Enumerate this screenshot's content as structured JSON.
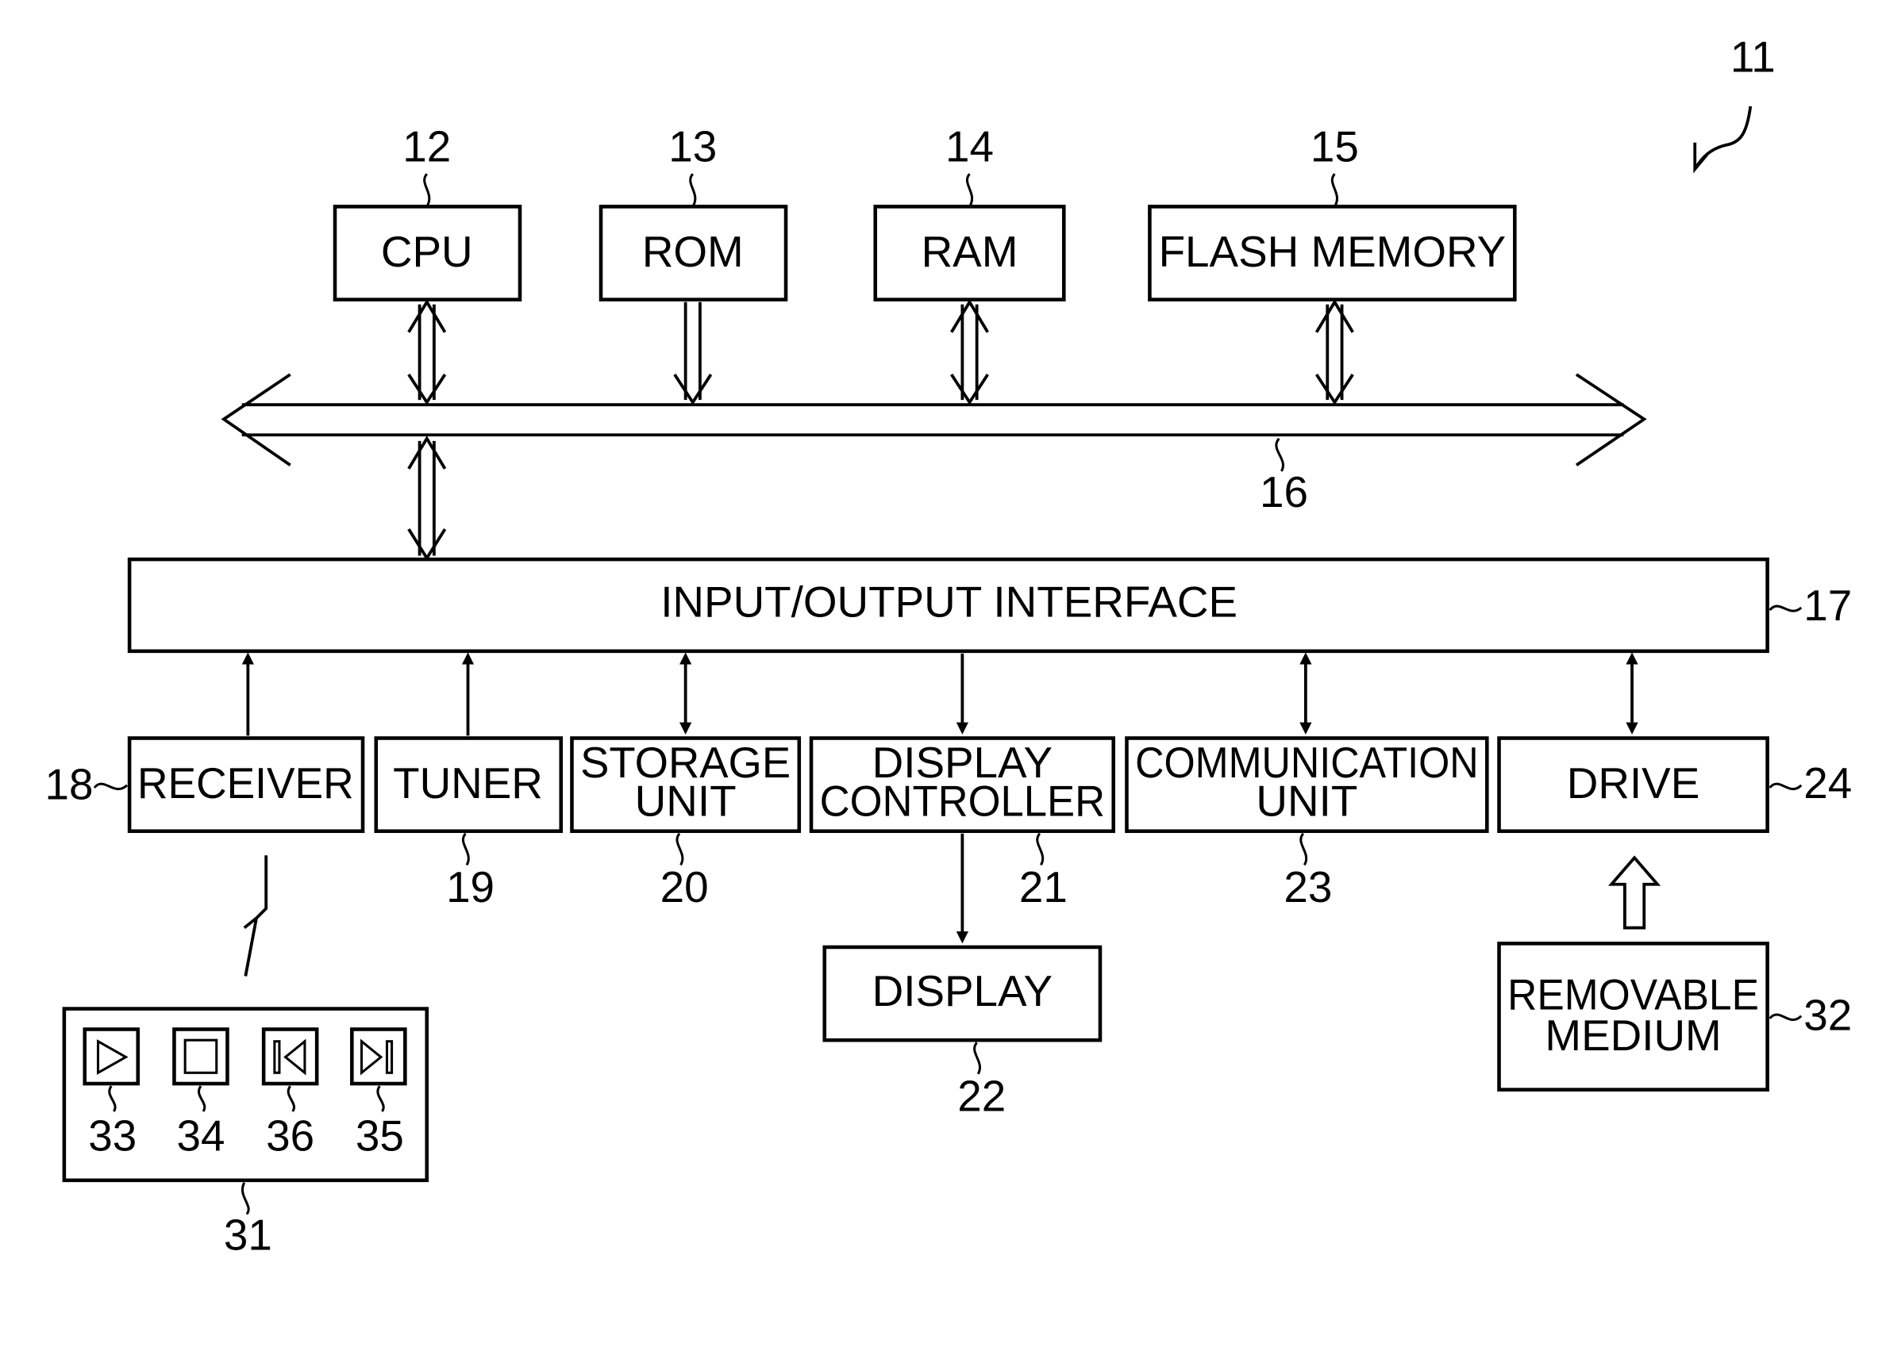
{
  "figure": {
    "ref": "11",
    "blocks": {
      "cpu": {
        "label": "CPU",
        "ref": "12"
      },
      "rom": {
        "label": "ROM",
        "ref": "13"
      },
      "ram": {
        "label": "RAM",
        "ref": "14"
      },
      "flash": {
        "label": "FLASH MEMORY",
        "ref": "15"
      },
      "bus": {
        "ref": "16"
      },
      "io": {
        "label": "INPUT/OUTPUT INTERFACE",
        "ref": "17"
      },
      "receiver": {
        "label": "RECEIVER",
        "ref": "18"
      },
      "tuner": {
        "label": "TUNER",
        "ref": "19"
      },
      "storage": {
        "label1": "STORAGE",
        "label2": "UNIT",
        "ref": "20"
      },
      "display_controller": {
        "label1": "DISPLAY",
        "label2": "CONTROLLER",
        "ref": "21"
      },
      "display": {
        "label": "DISPLAY",
        "ref": "22"
      },
      "communication": {
        "label1": "COMMUNICATION",
        "label2": "UNIT",
        "ref": "23"
      },
      "drive": {
        "label": "DRIVE",
        "ref": "24"
      },
      "remote": {
        "ref": "31"
      },
      "removable": {
        "label1": "REMOVABLE",
        "label2": "MEDIUM",
        "ref": "32"
      }
    },
    "remote_buttons": [
      {
        "icon": "play-icon",
        "ref": "33"
      },
      {
        "icon": "stop-icon",
        "ref": "34"
      },
      {
        "icon": "previous-icon",
        "ref": "36"
      },
      {
        "icon": "next-icon",
        "ref": "35"
      }
    ]
  }
}
